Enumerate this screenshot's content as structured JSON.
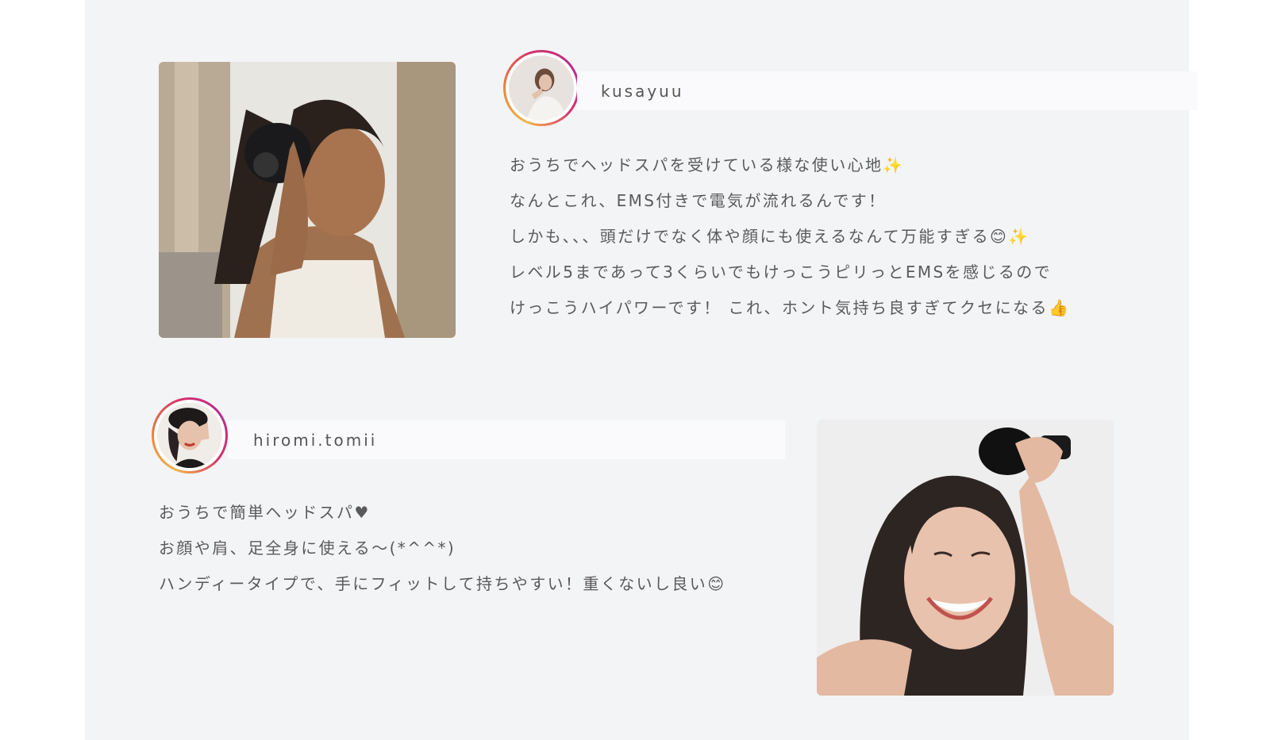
{
  "reviews": [
    {
      "username": "kusayuu",
      "lines": [
        "おうちでヘッドスパを受けている様な使い心地✨",
        "なんとこれ、EMS付きで電気が流れるんです！",
        "しかも、、、頭だけでなく体や顔にも使えるなんて万能すぎる😊✨",
        "レベル5まであって3くらいでもけっこうピリっとEMSを感じるので",
        "けっこうハイパワーです！ これ、ホント気持ち良すぎてクセになる👍"
      ]
    },
    {
      "username": "hiromi.tomii",
      "lines": [
        "おうちで簡単ヘッドスパ♥",
        "お顔や肩、足全身に使える〜(*^^*)",
        "ハンディータイプで、手にフィットして持ちやすい！重くないし良い😊"
      ]
    }
  ],
  "colors": {
    "panel": "#f3f4f6",
    "name_bar": "#fafafc",
    "text": "#5a5a5a",
    "ring_start": "#f4b24a",
    "ring_end": "#b62d8c"
  }
}
